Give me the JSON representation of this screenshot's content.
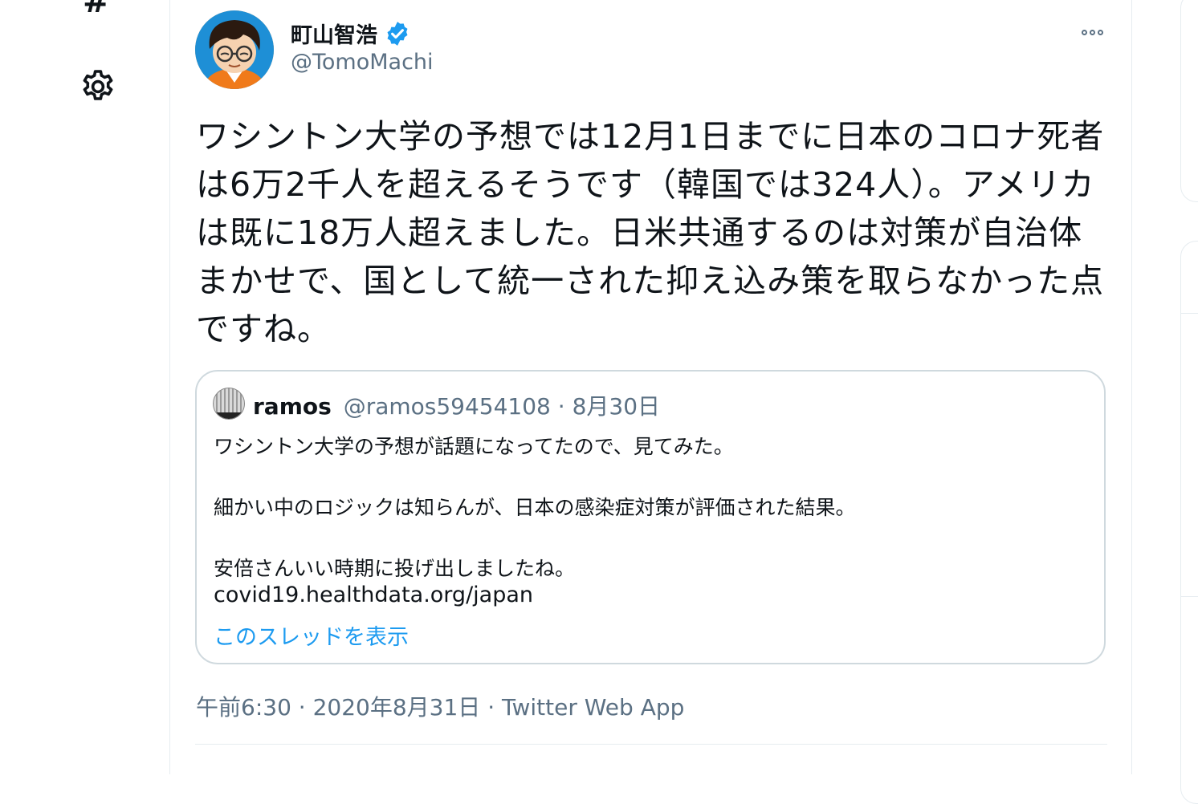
{
  "nav": {
    "icons": [
      "hashtag-icon",
      "gear-icon"
    ]
  },
  "tweet": {
    "author_name": "町山智浩",
    "author_handle": "@TomoMachi",
    "verified": true,
    "text": "ワシントン大学の予想では12月1日までに日本のコロナ死者は6万2千人を超えるそうです（韓国では324人）。アメリカは既に18万人超えました。日米共通するのは対策が自治体まかせで、国として統一された抑え込み策を取らなかった点ですね。",
    "timestamp": "午前6:30 · 2020年8月31日",
    "separator": "·",
    "source_app": "Twitter Web App"
  },
  "quote": {
    "author_name": "ramos",
    "author_handle": "@ramos59454108",
    "date": "8月30日",
    "meta": "@ramos59454108 · 8月30日",
    "lines": [
      "ワシントン大学の予想が話題になってたので、見てみた。",
      "細かい中のロジックは知らんが、日本の感染症対策が評価された結果。",
      "安倍さんいい時期に投げ出しましたね。"
    ],
    "link": "covid19.healthdata.org/japan",
    "show_thread": "このスレッドを表示"
  },
  "colors": {
    "text": "#0f1419",
    "secondary": "#5b7083",
    "accent": "#1d9bf0",
    "border": "#cfd9de"
  }
}
